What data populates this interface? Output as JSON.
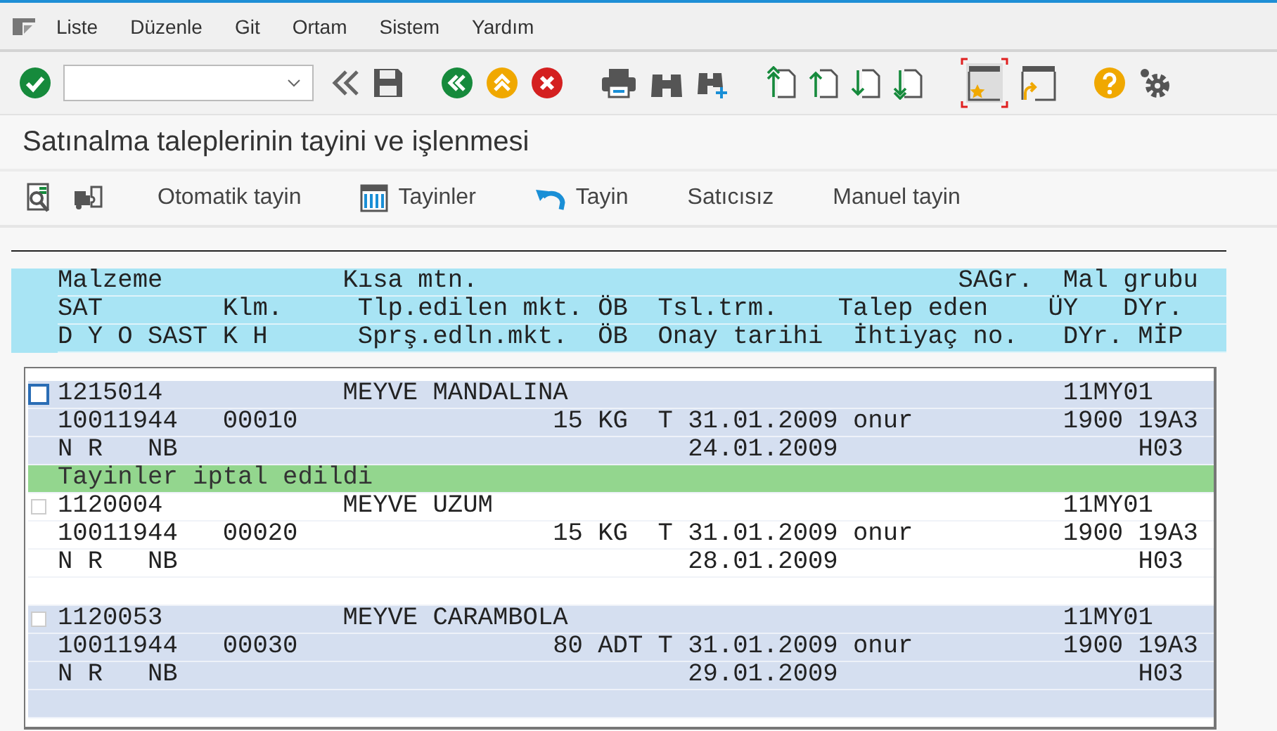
{
  "menu": [
    "Liste",
    "Düzenle",
    "Git",
    "Ortam",
    "Sistem",
    "Yardım"
  ],
  "title": "Satınalma taleplerinin tayini ve işlenmesi",
  "app_toolbar": [
    "Otomatik tayin",
    "Tayinler",
    "Tayin",
    "Satıcısız",
    "Manuel tayin"
  ],
  "list": {
    "header": [
      [
        "Malzeme",
        "Kısa mtn.",
        "SAGr.",
        "Mal grubu"
      ],
      [
        "SAT",
        "Klm.",
        "Tlp.edilen mkt.",
        "ÖB",
        "Tsl.trm.",
        "Talep eden",
        "ÜY",
        "DYr."
      ],
      [
        "D",
        "Y",
        "O",
        "SAST",
        "K",
        "H",
        "Sprş.edln.mkt.",
        "ÖB",
        "Onay tarihi",
        "İhtiyaç no.",
        "DYr.",
        "MİP"
      ]
    ],
    "items": [
      {
        "checked": false,
        "focused": true,
        "lines": [
          [
            "1215014",
            "MEYVE MANDALINA",
            "11MY01"
          ],
          [
            "10011944",
            "00010",
            "15",
            "KG",
            "T",
            "31.01.2009",
            "onur",
            "1900",
            "19A3"
          ],
          [
            "N",
            "R",
            "NB",
            "24.01.2009",
            "H03"
          ]
        ],
        "message": "Tayinler iptal edildi"
      },
      {
        "checked": false,
        "focused": false,
        "lines": [
          [
            "1120004",
            "MEYVE UZUM",
            "11MY01"
          ],
          [
            "10011944",
            "00020",
            "15",
            "KG",
            "T",
            "31.01.2009",
            "onur",
            "1900",
            "19A3"
          ],
          [
            "N",
            "R",
            "NB",
            "28.01.2009",
            "H03"
          ]
        ]
      },
      {
        "checked": false,
        "focused": false,
        "lines": [
          [
            "1120053",
            "MEYVE CARAMBOLA",
            "11MY01"
          ],
          [
            "10011944",
            "00030",
            "80",
            "ADT",
            "T",
            "31.01.2009",
            "onur",
            "1900",
            "19A3"
          ],
          [
            "N",
            "R",
            "NB",
            "29.01.2009",
            "H03"
          ]
        ]
      }
    ]
  }
}
